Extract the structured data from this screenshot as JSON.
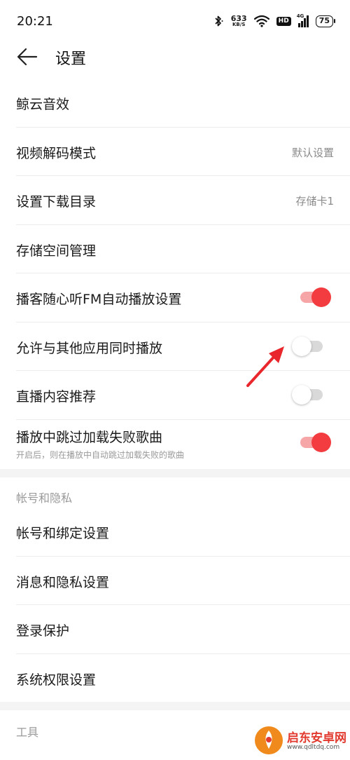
{
  "status_bar": {
    "time": "20:21",
    "net_speed": "633",
    "net_unit": "KB/S",
    "hd": "HD",
    "signal": "4G",
    "battery": "75",
    "icons": [
      "bluetooth-icon",
      "wifi-icon",
      "signal-icon",
      "battery-icon"
    ]
  },
  "header": {
    "title": "设置",
    "back_icon": "arrow-left-icon"
  },
  "settings": {
    "jingyun_effect": "鲸云音效",
    "video_decode": {
      "label": "视频解码模式",
      "value": "默认设置"
    },
    "download_dir": {
      "label": "设置下载目录",
      "value": "存储卡1"
    },
    "storage": "存储空间管理",
    "podcast_autoplay": {
      "label": "播客随心听FM自动播放设置",
      "on": true
    },
    "allow_simultaneous": {
      "label": "允许与其他应用同时播放",
      "on": false
    },
    "live_recommend": {
      "label": "直播内容推荐",
      "on": false
    },
    "skip_failed": {
      "label": "播放中跳过加载失败歌曲",
      "sub": "开启后，则在播放中自动跳过加载失败的歌曲",
      "on": true
    }
  },
  "account": {
    "section_title": "帐号和隐私",
    "binding": "帐号和绑定设置",
    "privacy": "消息和隐私设置",
    "login_protect": "登录保护",
    "permissions": "系统权限设置"
  },
  "tools": {
    "section_title": "工具"
  },
  "watermark": {
    "text": "启东安卓网",
    "url": "www.qdltdq.com"
  },
  "colors": {
    "accent": "#f23c40",
    "accent_track": "#f7a6a8",
    "secondary_text": "#8a8a8a",
    "section_gap": "#f4f4f4"
  }
}
